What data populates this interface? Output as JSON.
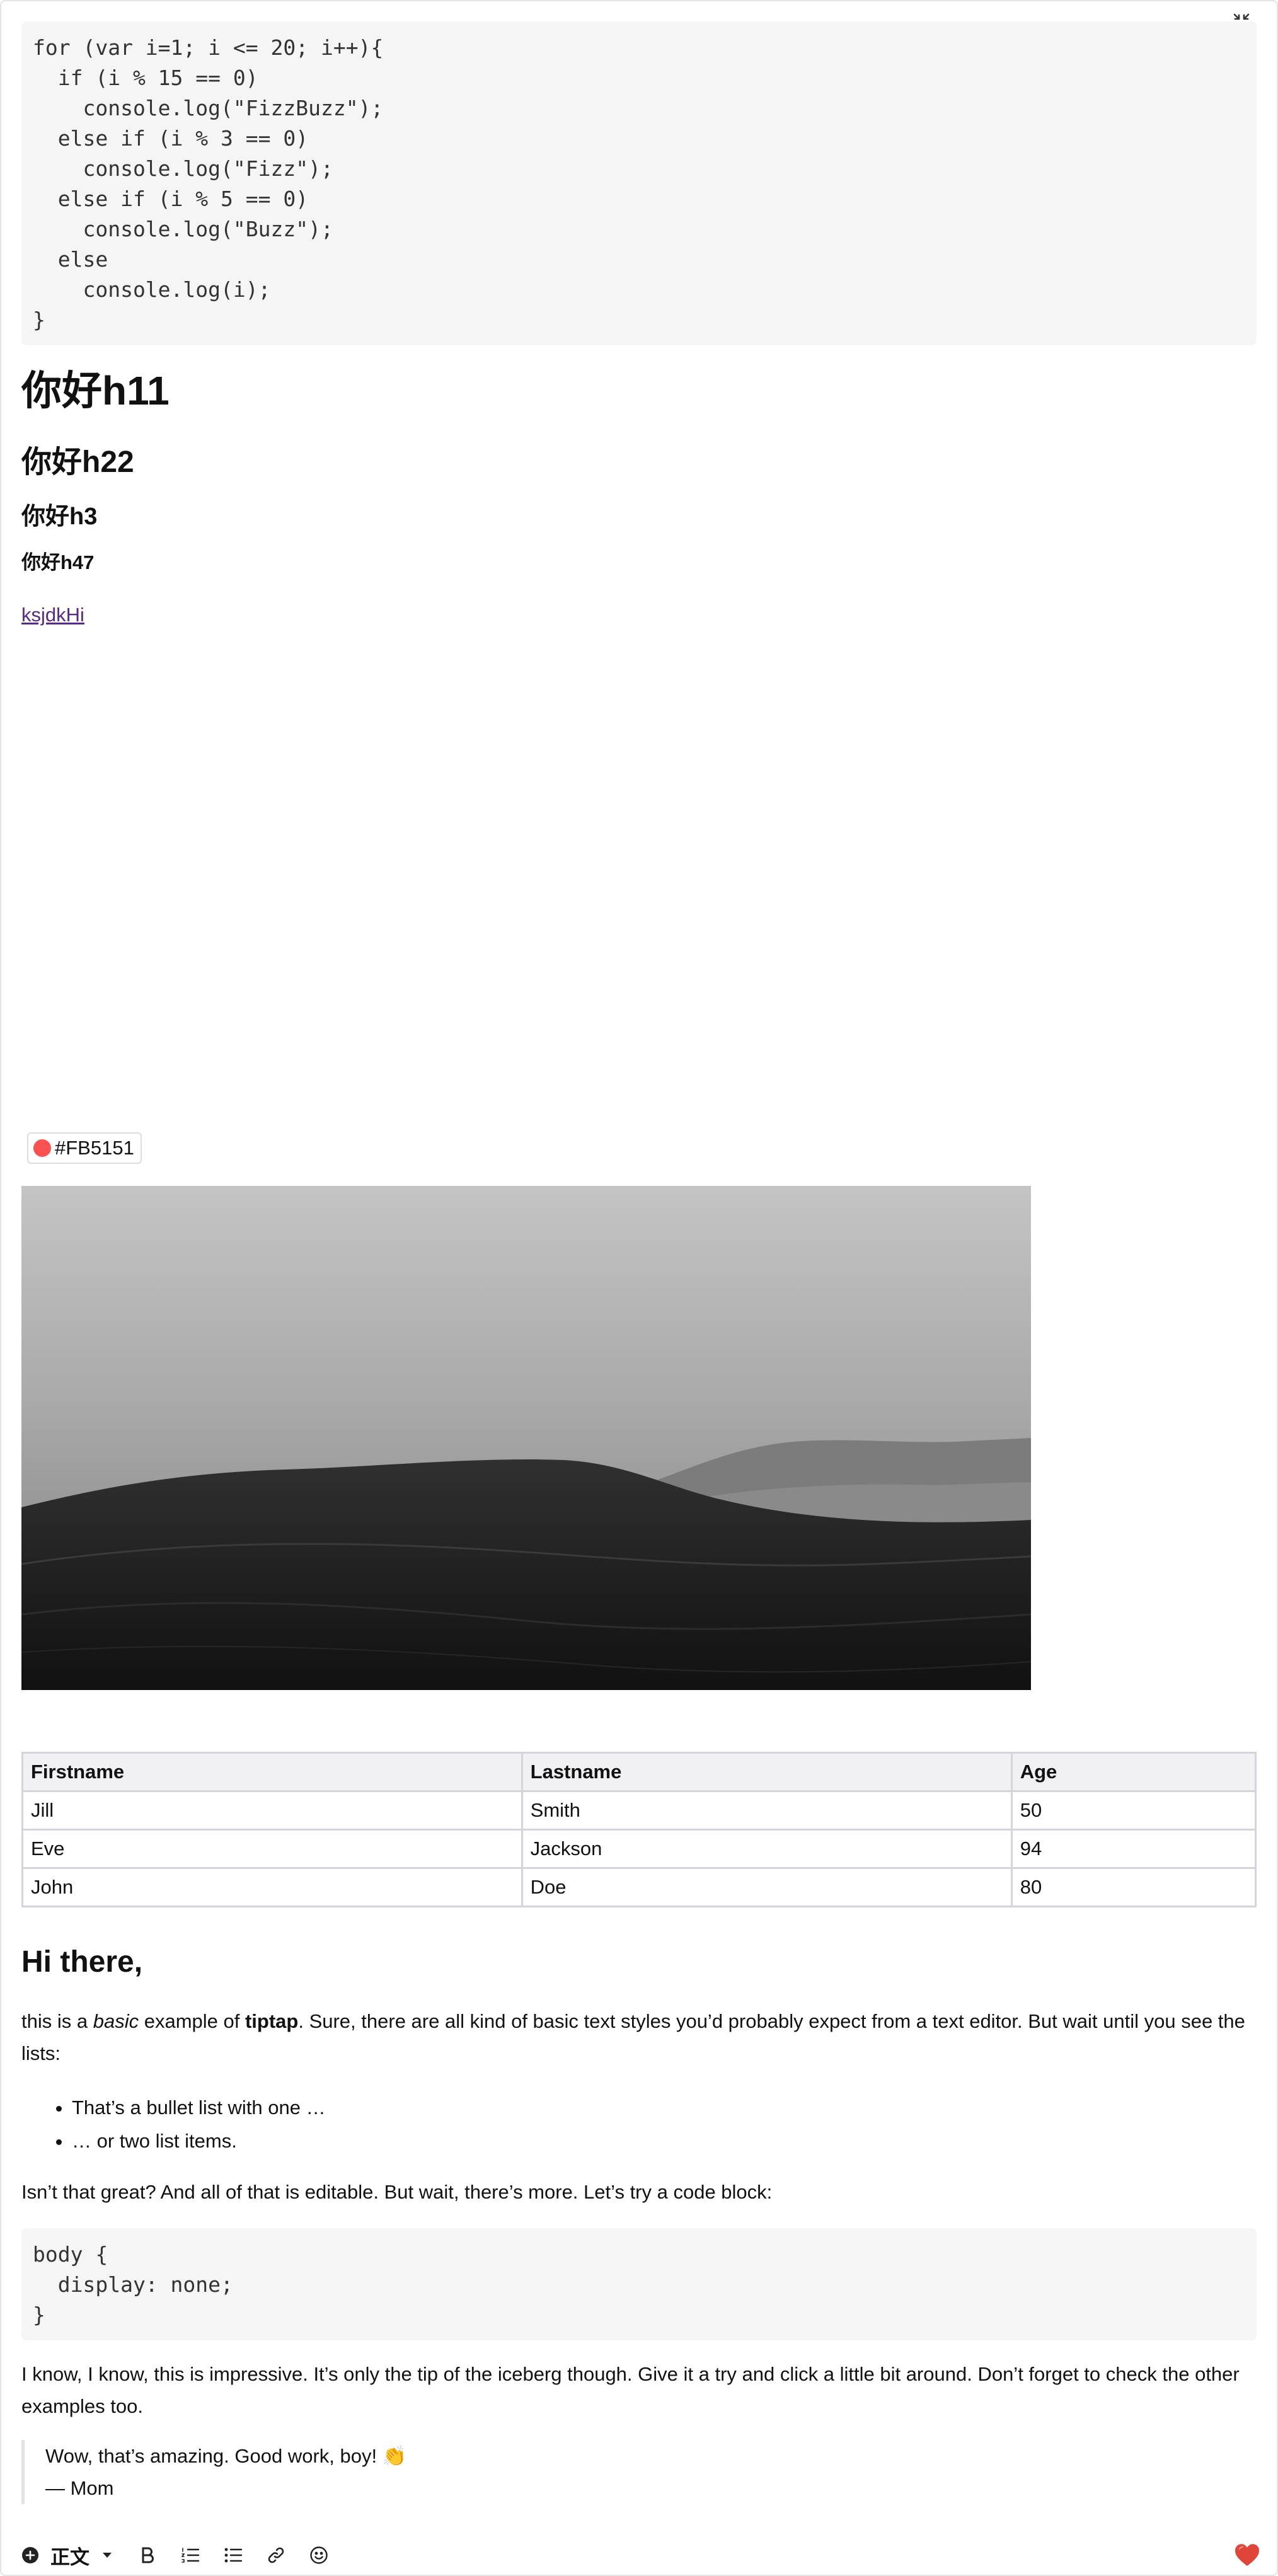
{
  "code_block_1": {
    "lines": [
      "for (var i=1; i <= 20; i++){",
      "  if (i % 15 == 0)",
      "    console.log(\"FizzBuzz\");",
      "  else if (i % 3 == 0)",
      "    console.log(\"Fizz\");",
      "  else if (i % 5 == 0)",
      "    console.log(\"Buzz\");",
      "  else",
      "    console.log(i);",
      "}"
    ]
  },
  "headings": {
    "h1": "你好h11",
    "h2": "你好h22",
    "h3": "你好h3",
    "h4": "你好h47"
  },
  "link_text": "ksjdkHi",
  "color_chip": {
    "label": "#FB5151",
    "color": "#FB5151"
  },
  "image": {
    "icon": "desert-dunes-photo"
  },
  "table": {
    "headers": [
      "Firstname",
      "Lastname",
      "Age"
    ],
    "rows": [
      [
        "Jill",
        "Smith",
        "50"
      ],
      [
        "Eve",
        "Jackson",
        "94"
      ],
      [
        "John",
        "Doe",
        "80"
      ]
    ]
  },
  "intro_heading": "Hi there,",
  "paragraph_1": {
    "before": "this is a ",
    "italic": "basic",
    "middle": " example of ",
    "bold": "tiptap",
    "after": ". Sure, there are all kind of basic text styles you’d probably expect from a text editor. But wait until you see the lists:"
  },
  "bullet_list": [
    "That’s a bullet list with one …",
    "… or two list items."
  ],
  "paragraph_2": "Isn’t that great? And all of that is editable. But wait, there’s more. Let’s try a code block:",
  "code_block_2": {
    "lines": [
      "body {",
      "  display: none;",
      "}"
    ]
  },
  "paragraph_3": "I know, I know, this is impressive. It’s only the tip of the iceberg though. Give it a try and click a little bit around. Don’t forget to check the other examples too.",
  "blockquote": {
    "line1": "Wow, that’s amazing. Good work, boy! 👏",
    "line2": "— Mom"
  },
  "toolbar": {
    "insert_icon": "plus-circle-icon",
    "paragraph_style": "正文",
    "icons": [
      "bold-icon",
      "ordered-list-icon",
      "bullet-list-icon",
      "link-icon",
      "emoji-icon"
    ],
    "like_icon": "heart-icon"
  },
  "colors": {
    "chip": "#FB5151",
    "heart": "#E0453A",
    "link": "#5B2A86",
    "code_bg": "#F5F5F5"
  }
}
